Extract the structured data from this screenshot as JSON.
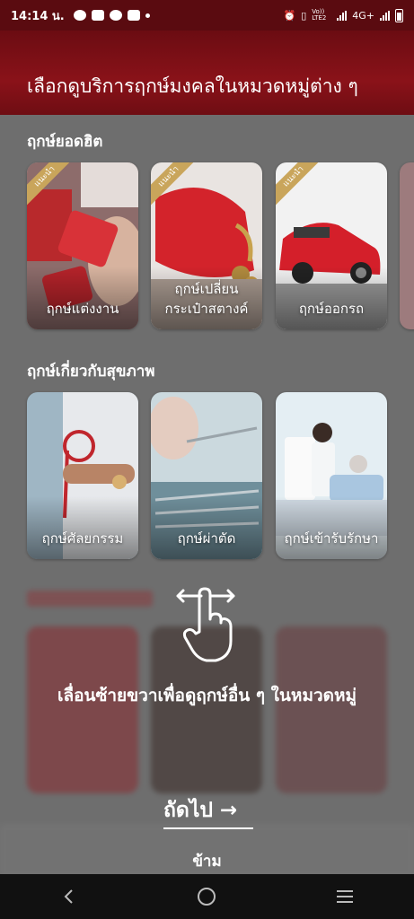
{
  "status_bar": {
    "time": "14:14 น.",
    "network": "4G+",
    "volte": "Vo)) LTE2"
  },
  "header": {
    "title": "เลือกดูบริการฤกษ์มงคลในหมวดหมู่ต่าง ๆ"
  },
  "sections": [
    {
      "title": "ฤกษ์ยอดฮิต",
      "cards": [
        {
          "label": "ฤกษ์แต่งงาน",
          "badge": "แนะนำ"
        },
        {
          "label": "ฤกษ์เปลี่ยน\nกระเป๋าสตางค์",
          "badge": "แนะนำ"
        },
        {
          "label": "ฤกษ์ออกรถ",
          "badge": "แนะนำ"
        }
      ]
    },
    {
      "title": "ฤกษ์เกี่ยวกับสุขภาพ",
      "cards": [
        {
          "label": "ฤกษ์ศัลยกรรม"
        },
        {
          "label": "ฤกษ์ผ่าตัด"
        },
        {
          "label": "ฤกษ์เข้ารับรักษา"
        }
      ]
    }
  ],
  "overlay": {
    "hint": "เลื่อนซ้ายขวาเพื่อดูฤกษ์อื่น ๆ ในหมวดหมู่",
    "next_label": "ถัดไป",
    "next_arrow": "→",
    "skip_label": "ข้าม"
  },
  "navbar": {
    "back": "‹",
    "home": "○",
    "recents": "≡"
  },
  "colors": {
    "header": "#8a1219",
    "badge": "#c9a55b",
    "dim": "#6e6e6e"
  }
}
